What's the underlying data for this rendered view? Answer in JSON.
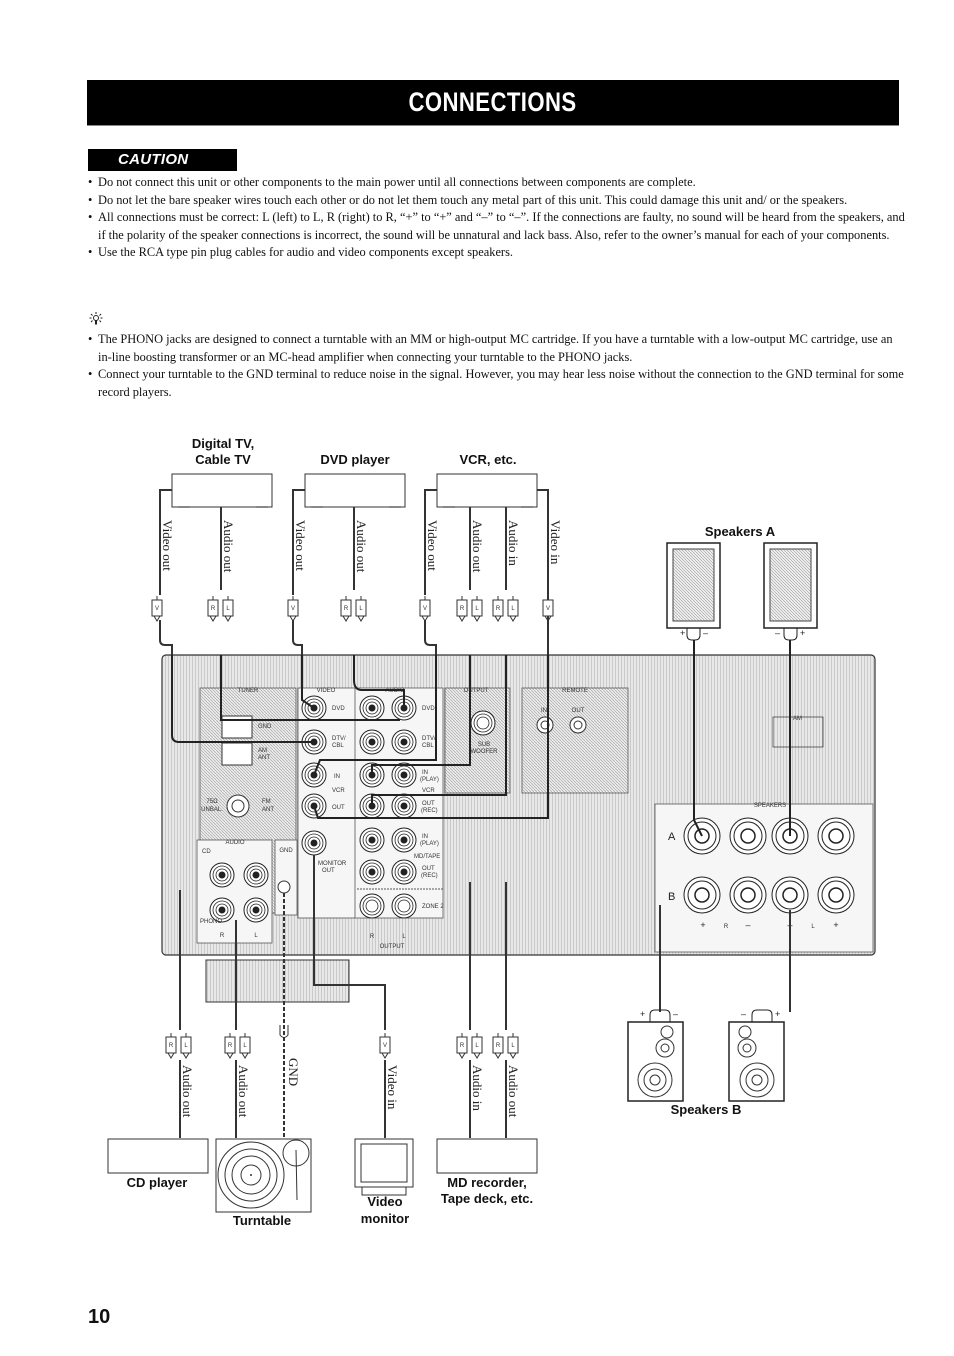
{
  "header": {
    "title": "CONNECTIONS"
  },
  "caution": {
    "label": "CAUTION",
    "items": [
      "Do not connect this unit or other components to the main power until all connections between components are complete.",
      "Do not let the bare speaker wires touch each other or do not let them touch any metal part of this unit. This could damage this unit and/ or the speakers.",
      "All connections must be correct: L (left) to L, R (right) to R, “+” to “+” and “–” to “–”. If the connections are faulty, no sound will be heard from the speakers, and if the polarity of the speaker connections is incorrect, the sound will be unnatural and lack bass. Also, refer to the owner’s manual for each of your components.",
      "Use the RCA type pin plug cables for audio and video components except speakers."
    ]
  },
  "tip": {
    "icon": "lightbulb-tip-icon",
    "items": [
      "The PHONO jacks are designed to connect a turntable with an MM or high-output MC cartridge. If you have a turntable with a low-output MC cartridge, use an in-line boosting transformer or an MC-head amplifier when connecting your turntable to the PHONO jacks.",
      "Connect your turntable to the GND terminal to reduce noise in the signal. However, you may hear less noise without the connection to the GND terminal for some record players."
    ]
  },
  "diagram": {
    "top_devices": [
      {
        "name": "Digital TV,",
        "name2": "Cable TV",
        "cables": [
          "Video out",
          "Audio out"
        ]
      },
      {
        "name": "DVD player",
        "cables": [
          "Video out",
          "Audio out"
        ]
      },
      {
        "name": "VCR, etc.",
        "cables": [
          "Video out",
          "Audio out",
          "Audio in",
          "Video in"
        ]
      }
    ],
    "speakers_a": {
      "label": "Speakers A",
      "left_polarity": [
        "+",
        "–"
      ],
      "right_polarity": [
        "–",
        "+"
      ]
    },
    "speakers_b": {
      "label": "Speakers B",
      "left_polarity": [
        "+",
        "–"
      ],
      "right_polarity": [
        "–",
        "+"
      ]
    },
    "plug_labels": {
      "video": "V",
      "right": "R",
      "left": "L"
    },
    "receiver": {
      "tuner": {
        "label": "TUNER",
        "gnd": "GND",
        "am": "AM",
        "ant": "ANT",
        "fm1": "75Ω",
        "fm2": "UNBAL.",
        "fm3": "FM",
        "fm4": "ANT"
      },
      "video": {
        "label": "VIDEO",
        "dvd": "DVD",
        "dtv1": "DTV/",
        "dtv2": "CBL",
        "in": "IN",
        "vcr": "VCR",
        "out": "OUT",
        "mon1": "MONITOR",
        "mon2": "OUT"
      },
      "audio": {
        "label": "AUDIO",
        "dvd": "DVD",
        "dtv1": "DTV/",
        "dtv2": "CBL",
        "in1": "IN",
        "in2": "(PLAY)",
        "vcr": "VCR",
        "out1": "OUT",
        "out2": "(REC)",
        "mdtape": "MD/TAPE",
        "zone2": "ZONE 2",
        "output": "OUTPUT",
        "r": "R",
        "l": "L"
      },
      "output": {
        "label": "OUTPUT",
        "sub1": "SUB",
        "sub2": "WOOFER"
      },
      "remote": {
        "label": "REMOTE",
        "in": "IN",
        "out": "OUT"
      },
      "audio_cd": {
        "label": "AUDIO",
        "cd": "CD",
        "phono": "PHONO",
        "gnd": "GND",
        "r": "R",
        "l": "L"
      },
      "speakers": {
        "label": "SPEAKERS",
        "a": "A",
        "b": "B",
        "plus": "+",
        "minus": "–",
        "r": "R",
        "l": "L"
      },
      "am_label": "AM"
    },
    "bottom_devices": [
      {
        "name": "CD player",
        "cables": [
          "Audio out"
        ]
      },
      {
        "name": "Turntable",
        "cables": [
          "Audio out",
          "GND"
        ]
      },
      {
        "name": "Video",
        "name2": "monitor",
        "cables": [
          "Video in"
        ]
      },
      {
        "name": "MD recorder,",
        "name2": "Tape deck, etc.",
        "cables": [
          "Audio in",
          "Audio out"
        ]
      }
    ]
  },
  "footer": {
    "page_number": "10"
  }
}
